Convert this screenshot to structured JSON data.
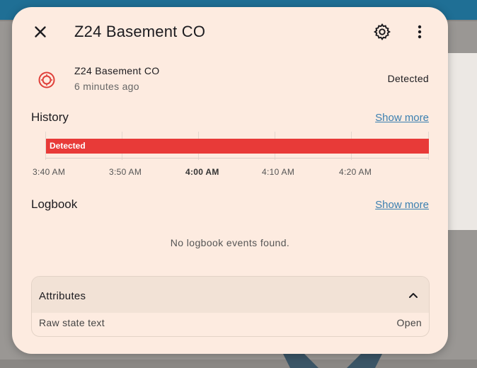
{
  "dialog": {
    "title": "Z24 Basement CO"
  },
  "entity": {
    "name": "Z24 Basement CO",
    "last_changed": "6 minutes ago",
    "state": "Detected",
    "icon": "smoke-detector-icon",
    "state_color": "#e83a38"
  },
  "history": {
    "title": "History",
    "show_more": "Show more",
    "timeline": {
      "state_label": "Detected",
      "ticks": [
        "3:40 AM",
        "3:50 AM",
        "4:00 AM",
        "4:10 AM",
        "4:20 AM"
      ],
      "bold_tick": "4:00 AM"
    }
  },
  "logbook": {
    "title": "Logbook",
    "show_more": "Show more",
    "empty_message": "No logbook events found."
  },
  "attributes": {
    "title": "Attributes",
    "rows": [
      {
        "key": "Raw state text",
        "value": "Open"
      }
    ]
  },
  "colors": {
    "dialog_bg": "#fdebe0",
    "accent_link": "#3a7fb0",
    "bar": "#e83a38"
  }
}
